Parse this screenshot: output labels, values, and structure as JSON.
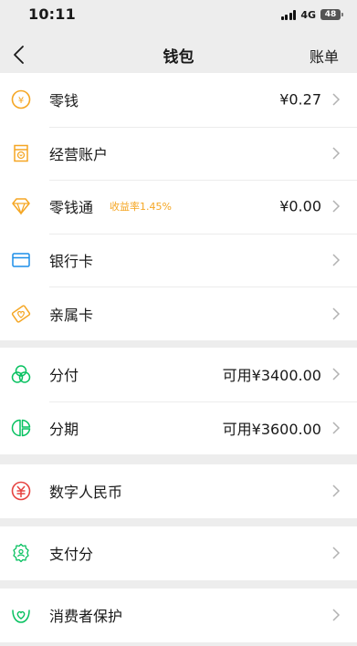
{
  "status_bar": {
    "time": "10:11",
    "network": "4G",
    "battery": "48"
  },
  "nav": {
    "title": "钱包",
    "right_label": "账单"
  },
  "colors": {
    "accent": "#f5a623",
    "green": "#07c160",
    "blue": "#1b8ee8",
    "red": "#e64340"
  },
  "sections": [
    {
      "items": [
        {
          "label": "零钱",
          "value": "¥0.27",
          "icon": "yuan-coin-icon"
        },
        {
          "label": "经营账户",
          "value": "",
          "icon": "business-account-icon"
        },
        {
          "label": "零钱通",
          "tag": "收益率1.45%",
          "value": "¥0.00",
          "icon": "diamond-icon"
        },
        {
          "label": "银行卡",
          "value": "",
          "icon": "bank-card-icon"
        },
        {
          "label": "亲属卡",
          "value": "",
          "icon": "family-card-icon"
        }
      ]
    },
    {
      "items": [
        {
          "label": "分付",
          "value": "可用¥3400.00",
          "icon": "fenfu-icon"
        },
        {
          "label": "分期",
          "value": "可用¥3600.00",
          "icon": "installment-icon"
        }
      ]
    },
    {
      "items": [
        {
          "label": "数字人民币",
          "value": "",
          "icon": "digital-rmb-icon"
        }
      ]
    },
    {
      "items": [
        {
          "label": "支付分",
          "value": "",
          "icon": "pay-score-icon"
        }
      ]
    },
    {
      "items": [
        {
          "label": "消费者保护",
          "value": "",
          "icon": "consumer-protection-icon"
        }
      ]
    }
  ]
}
